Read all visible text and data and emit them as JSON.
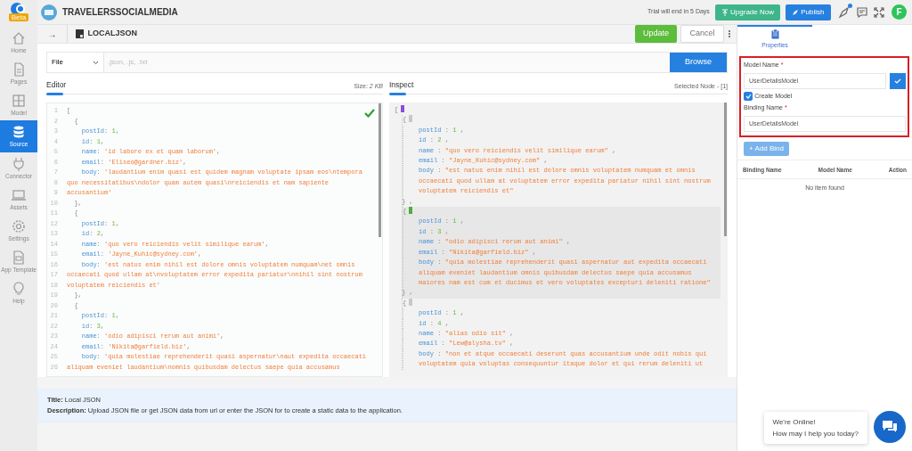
{
  "app": {
    "beta": "Beta",
    "project": "TRAVELERSSOCIALMEDIA",
    "trial": "Trial will end in 5 Days",
    "upgrade": "Upgrade Now",
    "publish": "Publish",
    "avatar": "F",
    "notification": true
  },
  "sidebar": [
    {
      "label": "Home",
      "selected": false
    },
    {
      "label": "Pages",
      "selected": false
    },
    {
      "label": "Model",
      "selected": false
    },
    {
      "label": "Source",
      "selected": true
    },
    {
      "label": "Connector",
      "selected": false
    },
    {
      "label": "Assets",
      "selected": false
    },
    {
      "label": "Settings",
      "selected": false
    },
    {
      "label": "App Template",
      "selected": false
    },
    {
      "label": "Help",
      "selected": false
    }
  ],
  "subbar": {
    "back": "→",
    "title": "LOCALJSON",
    "update": "Update",
    "cancel": "Cancel"
  },
  "source": {
    "type": "File",
    "placeholder": ".json, .js, .txt",
    "browse": "Browse"
  },
  "editor": {
    "tab": "Editor",
    "size_label": "Size:",
    "size": "2 KB",
    "valid": true,
    "lines": [
      {
        "number": "1",
        "segs": [
          {
            "kind": "punct",
            "text": "["
          }
        ]
      },
      {
        "number": "2",
        "segs": [
          {
            "kind": "punct",
            "text": "  {"
          }
        ]
      },
      {
        "number": "3",
        "segs": [
          {
            "kind": "key",
            "text": "    postId"
          },
          {
            "kind": "punct",
            "text": ": "
          },
          {
            "kind": "number",
            "text": "1"
          },
          {
            "kind": "punct",
            "text": ","
          }
        ]
      },
      {
        "number": "4",
        "segs": [
          {
            "kind": "key",
            "text": "    id"
          },
          {
            "kind": "punct",
            "text": ": "
          },
          {
            "kind": "number",
            "text": "1"
          },
          {
            "kind": "punct",
            "text": ","
          }
        ]
      },
      {
        "number": "5",
        "segs": [
          {
            "kind": "key",
            "text": "    name"
          },
          {
            "kind": "punct",
            "text": ": "
          },
          {
            "kind": "string",
            "text": "'id labore ex et quam laborum'"
          },
          {
            "kind": "punct",
            "text": ","
          }
        ]
      },
      {
        "number": "6",
        "segs": [
          {
            "kind": "key",
            "text": "    email"
          },
          {
            "kind": "punct",
            "text": ": "
          },
          {
            "kind": "string",
            "text": "'Eliseo@gardner.biz'"
          },
          {
            "kind": "punct",
            "text": ","
          }
        ]
      },
      {
        "number": "7",
        "segs": [
          {
            "kind": "key",
            "text": "    body"
          },
          {
            "kind": "punct",
            "text": ": "
          },
          {
            "kind": "string",
            "text": "'laudantium enim quasi est quidem magnam voluptate ipsam eos\\ntempora"
          }
        ]
      },
      {
        "number": "8",
        "segs": [
          {
            "kind": "string",
            "text": "quo necessitatibus\\ndolor quam autem quasi\\nreiciendis et nam sapiente"
          }
        ]
      },
      {
        "number": "9",
        "segs": [
          {
            "kind": "string",
            "text": "accusantium'"
          }
        ]
      },
      {
        "number": "10",
        "segs": [
          {
            "kind": "punct",
            "text": "  },"
          }
        ]
      },
      {
        "number": "11",
        "segs": [
          {
            "kind": "punct",
            "text": "  {"
          }
        ]
      },
      {
        "number": "12",
        "segs": [
          {
            "kind": "key",
            "text": "    postId"
          },
          {
            "kind": "punct",
            "text": ": "
          },
          {
            "kind": "number",
            "text": "1"
          },
          {
            "kind": "punct",
            "text": ","
          }
        ]
      },
      {
        "number": "13",
        "segs": [
          {
            "kind": "key",
            "text": "    id"
          },
          {
            "kind": "punct",
            "text": ": "
          },
          {
            "kind": "number",
            "text": "2"
          },
          {
            "kind": "punct",
            "text": ","
          }
        ]
      },
      {
        "number": "14",
        "segs": [
          {
            "kind": "key",
            "text": "    name"
          },
          {
            "kind": "punct",
            "text": ": "
          },
          {
            "kind": "string",
            "text": "'quo vero reiciendis velit similique earum'"
          },
          {
            "kind": "punct",
            "text": ","
          }
        ]
      },
      {
        "number": "15",
        "segs": [
          {
            "kind": "key",
            "text": "    email"
          },
          {
            "kind": "punct",
            "text": ": "
          },
          {
            "kind": "string",
            "text": "'Jayne_Kuhic@sydney.com'"
          },
          {
            "kind": "punct",
            "text": ","
          }
        ]
      },
      {
        "number": "16",
        "segs": [
          {
            "kind": "key",
            "text": "    body"
          },
          {
            "kind": "punct",
            "text": ": "
          },
          {
            "kind": "string",
            "text": "'est natus enim nihil est dolore omnis voluptatem numquam\\net omnis"
          }
        ]
      },
      {
        "number": "17",
        "segs": [
          {
            "kind": "string",
            "text": "occaecati quod ullam at\\nvoluptatem error expedita pariatur\\nnihil sint nostrum"
          }
        ]
      },
      {
        "number": "18",
        "segs": [
          {
            "kind": "string",
            "text": "voluptatem reiciendis et'"
          }
        ]
      },
      {
        "number": "19",
        "segs": [
          {
            "kind": "punct",
            "text": "  },"
          }
        ]
      },
      {
        "number": "20",
        "segs": [
          {
            "kind": "punct",
            "text": "  {"
          }
        ]
      },
      {
        "number": "21",
        "segs": [
          {
            "kind": "key",
            "text": "    postId"
          },
          {
            "kind": "punct",
            "text": ": "
          },
          {
            "kind": "number",
            "text": "1"
          },
          {
            "kind": "punct",
            "text": ","
          }
        ]
      },
      {
        "number": "22",
        "segs": [
          {
            "kind": "key",
            "text": "    id"
          },
          {
            "kind": "punct",
            "text": ": "
          },
          {
            "kind": "number",
            "text": "3"
          },
          {
            "kind": "punct",
            "text": ","
          }
        ]
      },
      {
        "number": "23",
        "segs": [
          {
            "kind": "key",
            "text": "    name"
          },
          {
            "kind": "punct",
            "text": ": "
          },
          {
            "kind": "string",
            "text": "'odio adipisci rerum aut animi'"
          },
          {
            "kind": "punct",
            "text": ","
          }
        ]
      },
      {
        "number": "24",
        "segs": [
          {
            "kind": "key",
            "text": "    email"
          },
          {
            "kind": "punct",
            "text": ": "
          },
          {
            "kind": "string",
            "text": "'Nikita@garfield.biz'"
          },
          {
            "kind": "punct",
            "text": ","
          }
        ]
      },
      {
        "number": "25",
        "segs": [
          {
            "kind": "key",
            "text": "    body"
          },
          {
            "kind": "punct",
            "text": ": "
          },
          {
            "kind": "string",
            "text": "'quia molestiae reprehenderit quasi aspernatur\\naut expedita occaecati"
          }
        ]
      },
      {
        "number": "26",
        "segs": [
          {
            "kind": "string",
            "text": "aliquam eveniet laudantium\\nomnis quibusdam delectus saepe quia accusamus"
          }
        ]
      }
    ]
  },
  "inspect": {
    "tab": "Inspect",
    "selected_node": "Selected Node - [1]",
    "open": "[",
    "items": [
      {
        "selected": false,
        "open": "{",
        "close": "} ,",
        "fields": [
          {
            "key": "postId",
            "sep": " : ",
            "kind": "number",
            "value": "1",
            "trail": " ,"
          },
          {
            "key": "id",
            "sep": " : ",
            "kind": "number",
            "value": "2",
            "trail": " ,"
          },
          {
            "key": "name",
            "sep": " : ",
            "kind": "string",
            "value": "\"quo vero reiciendis velit similique earum\"",
            "trail": " ,"
          },
          {
            "key": "email",
            "sep": " : ",
            "kind": "string",
            "value": "\"Jayne_Kuhic@sydney.com\"",
            "trail": " ,"
          },
          {
            "key": "body",
            "sep": " : ",
            "kind": "string",
            "value": "\"est natus enim nihil est dolore omnis voluptatem numquam et omnis occaecati quod ullam at voluptatem error expedita pariatur nihil sint nostrum voluptatem reiciendis et\""
          }
        ]
      },
      {
        "selected": true,
        "open": "{",
        "close": "} ,",
        "fields": [
          {
            "key": "postId",
            "sep": " : ",
            "kind": "number",
            "value": "1",
            "trail": " ,"
          },
          {
            "key": "id",
            "sep": " : ",
            "kind": "number",
            "value": "3",
            "trail": " ,"
          },
          {
            "key": "name",
            "sep": " : ",
            "kind": "string",
            "value": "\"odio adipisci rerum aut animi\"",
            "trail": " ,"
          },
          {
            "key": "email",
            "sep": " : ",
            "kind": "string",
            "value": "\"Nikita@garfield.biz\"",
            "trail": " ,"
          },
          {
            "key": "body",
            "sep": " : ",
            "kind": "string",
            "value": "\"quia molestiae reprehenderit quasi aspernatur aut expedita occaecati aliquam eveniet laudantium omnis quibusdam delectus saepe quia accusamus maiores nam est cum et ducimus et vero voluptates excepturi deleniti ratione\""
          }
        ]
      },
      {
        "selected": false,
        "open": "{",
        "fields": [
          {
            "key": "postId",
            "sep": " : ",
            "kind": "number",
            "value": "1",
            "trail": " ,"
          },
          {
            "key": "id",
            "sep": " : ",
            "kind": "number",
            "value": "4",
            "trail": " ,"
          },
          {
            "key": "name",
            "sep": " : ",
            "kind": "string",
            "value": "\"alias odio sit\"",
            "trail": " ,"
          },
          {
            "key": "email",
            "sep": " : ",
            "kind": "string",
            "value": "\"Lew@alysha.tv\"",
            "trail": " ,"
          },
          {
            "key": "body",
            "sep": " : ",
            "kind": "string",
            "value": "\"non et atque occaecati deserunt quas accusantium unde odit nobis qui voluptatem quia voluptas consequuntur itaque dolor et qui rerum deleniti ut"
          }
        ]
      }
    ]
  },
  "info": {
    "title": "**Title:** Local JSON",
    "description": "**Description:** Upload JSON file or get JSON data from url or enter the JSON for to create a static data to the application."
  },
  "properties": {
    "tab": "Properties",
    "model_label": "Model Name",
    "required_mark": "*",
    "model_value": "UserDetailsModel",
    "create_model": {
      "label": "Create Model",
      "checked": true
    },
    "binding_label": "Binding Name",
    "binding_value": "UserDetailsModel",
    "add_bind": "+ Add Bind",
    "columns": [
      "Binding Name",
      "Model Name",
      "Action"
    ],
    "empty": "No item found"
  },
  "chat": {
    "title": "We're Online!",
    "subtitle": "How may I help you today?"
  }
}
